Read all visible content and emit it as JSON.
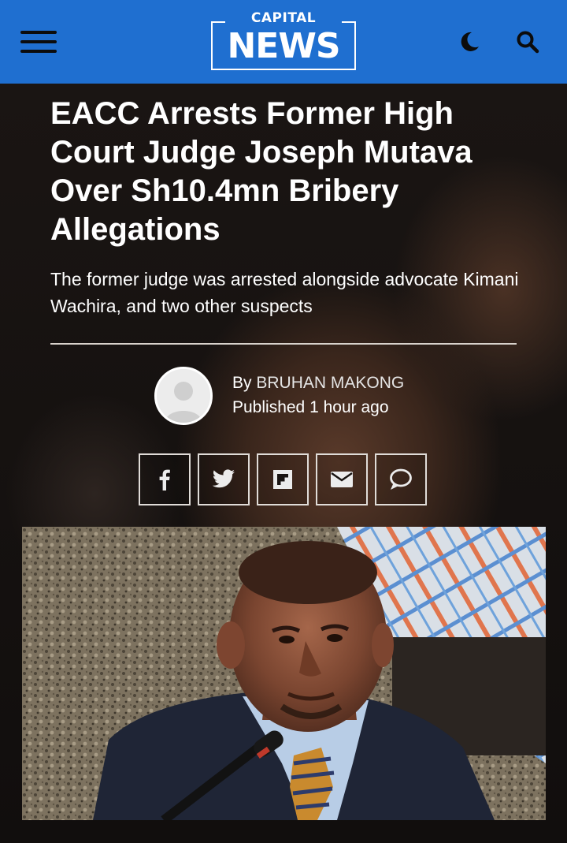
{
  "header": {
    "logo_top": "CAPITAL",
    "logo_main": "NEWS",
    "brand_color": "#1f6fd0",
    "icons": [
      "menu-icon",
      "dark-mode-icon",
      "search-icon"
    ]
  },
  "article": {
    "headline": "EACC Arrests Former High Court Judge Joseph Mutava Over Sh10.4mn Bribery Allegations",
    "subhead": "The former judge was arrested alongside advocate Kimani Wachira, and two other suspects",
    "by_label": "By",
    "author": "BRUHAN MAKONG",
    "published_label": "Published",
    "published_time": "1 hour ago"
  },
  "share": {
    "buttons": [
      "facebook-icon",
      "twitter-icon",
      "flipboard-icon",
      "email-icon",
      "comment-icon"
    ]
  }
}
